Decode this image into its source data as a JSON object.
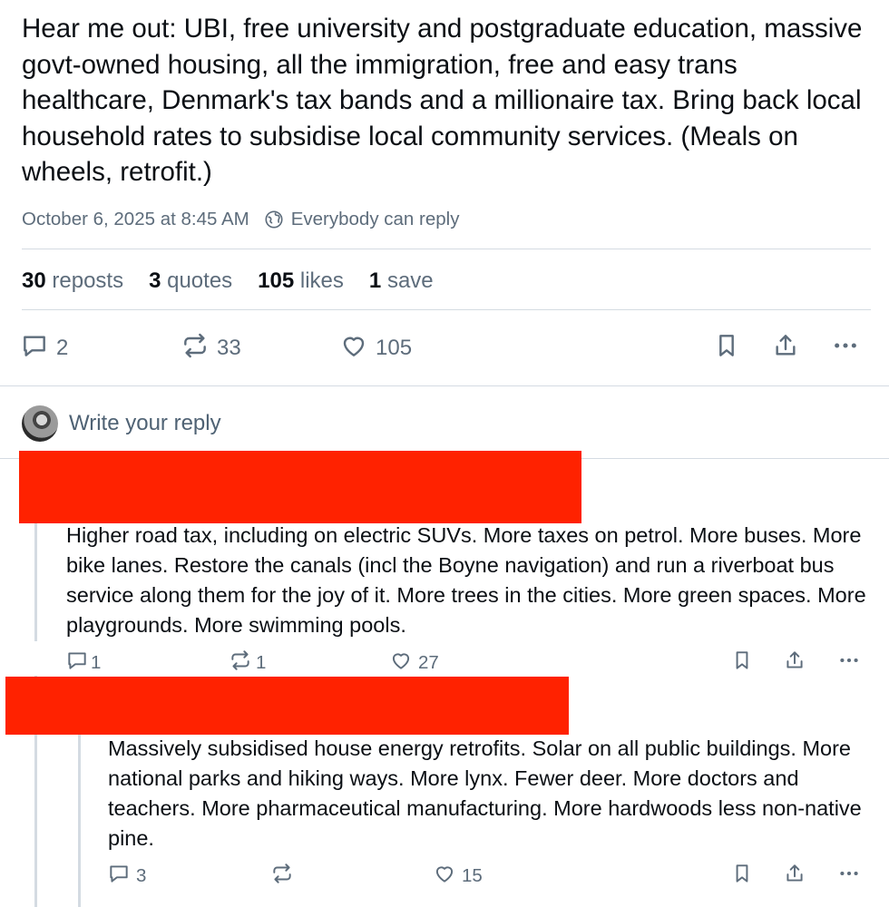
{
  "post": {
    "text": "Hear me out: UBI, free university and postgraduate education, massive govt-owned housing, all the immigration, free and easy trans healthcare, Denmark's tax bands and a millionaire tax. Bring back local household rates to subsidise local community services. (Meals on wheels, retrofit.)",
    "timestamp": "October 6, 2025 at 8:45 AM",
    "reply_setting": "Everybody can reply",
    "stats": {
      "reposts_num": "30",
      "reposts_label": "reposts",
      "quotes_num": "3",
      "quotes_label": "quotes",
      "likes_num": "105",
      "likes_label": "likes",
      "saves_num": "1",
      "saves_label": "save"
    },
    "actions": {
      "replies": "2",
      "reposts": "33",
      "likes": "105"
    }
  },
  "reply_box": {
    "placeholder": "Write your reply"
  },
  "replies": [
    {
      "text": "Higher road tax, including on electric SUVs. More taxes on petrol. More buses. More bike lanes. Restore the canals (incl the Boyne navigation) and run a riverboat bus service along them for the joy of it. More trees in the cities. More green spaces. More playgrounds. More swimming pools.",
      "replies": "1",
      "reposts": "1",
      "likes": "27"
    },
    {
      "text": "Massively subsidised house energy retrofits. Solar on all public buildings. More national parks and hiking ways. More lynx. Fewer deer. More doctors and teachers. More pharmaceutical manufacturing. More hardwoods less non-native pine.",
      "replies": "3",
      "reposts": "",
      "likes": "15"
    }
  ],
  "icons": {
    "reply": "speech-bubble-icon",
    "repost": "repost-arrows-icon",
    "like": "heart-icon",
    "bookmark": "bookmark-icon",
    "share": "share-icon",
    "more": "more-dots-icon",
    "globe": "globe-icon"
  },
  "colors": {
    "text": "#0b0f14",
    "muted": "#5d6c7b",
    "divider": "#d4dbe2",
    "redaction": "#ff2200"
  }
}
